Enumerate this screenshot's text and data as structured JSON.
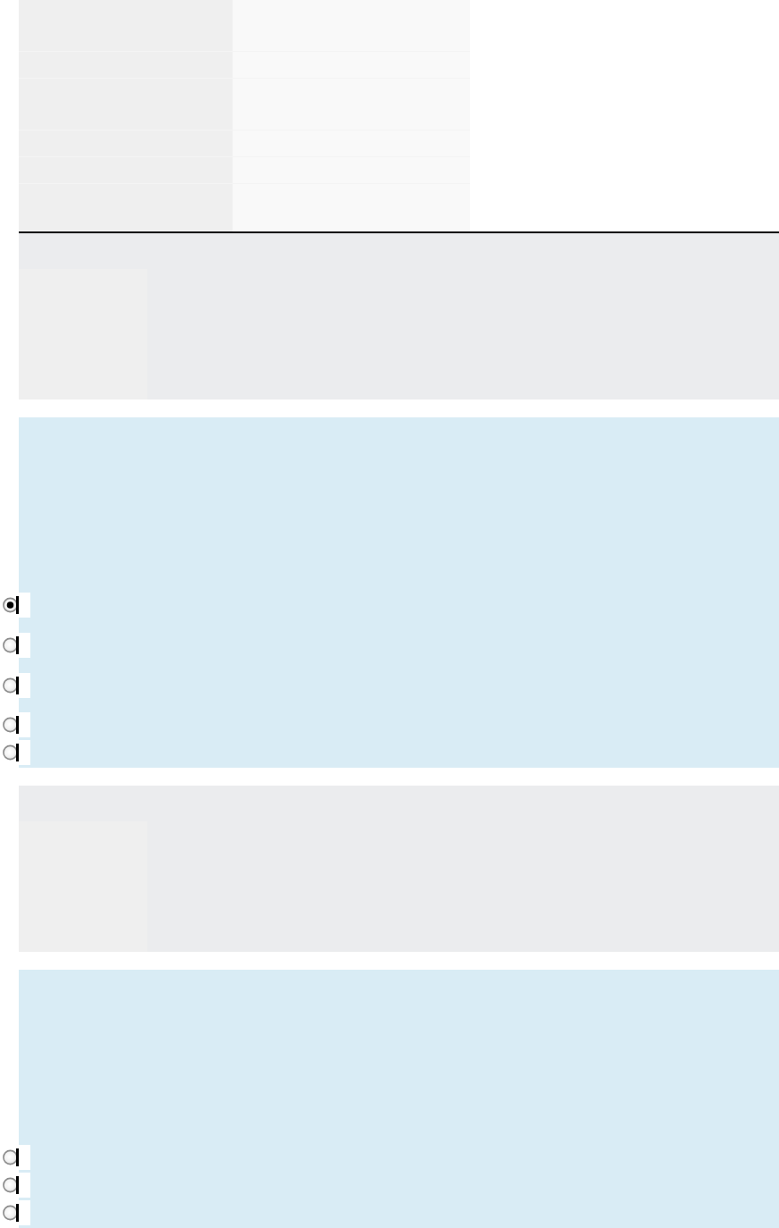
{
  "sections": [
    {
      "kind": "panel"
    },
    {
      "kind": "question",
      "options": [
        {
          "selected": true
        },
        {
          "selected": false
        },
        {
          "selected": false
        },
        {
          "selected": false
        },
        {
          "selected": false
        }
      ]
    },
    {
      "kind": "panel"
    },
    {
      "kind": "question",
      "options": [
        {
          "selected": false
        },
        {
          "selected": false
        },
        {
          "selected": false
        }
      ]
    }
  ]
}
